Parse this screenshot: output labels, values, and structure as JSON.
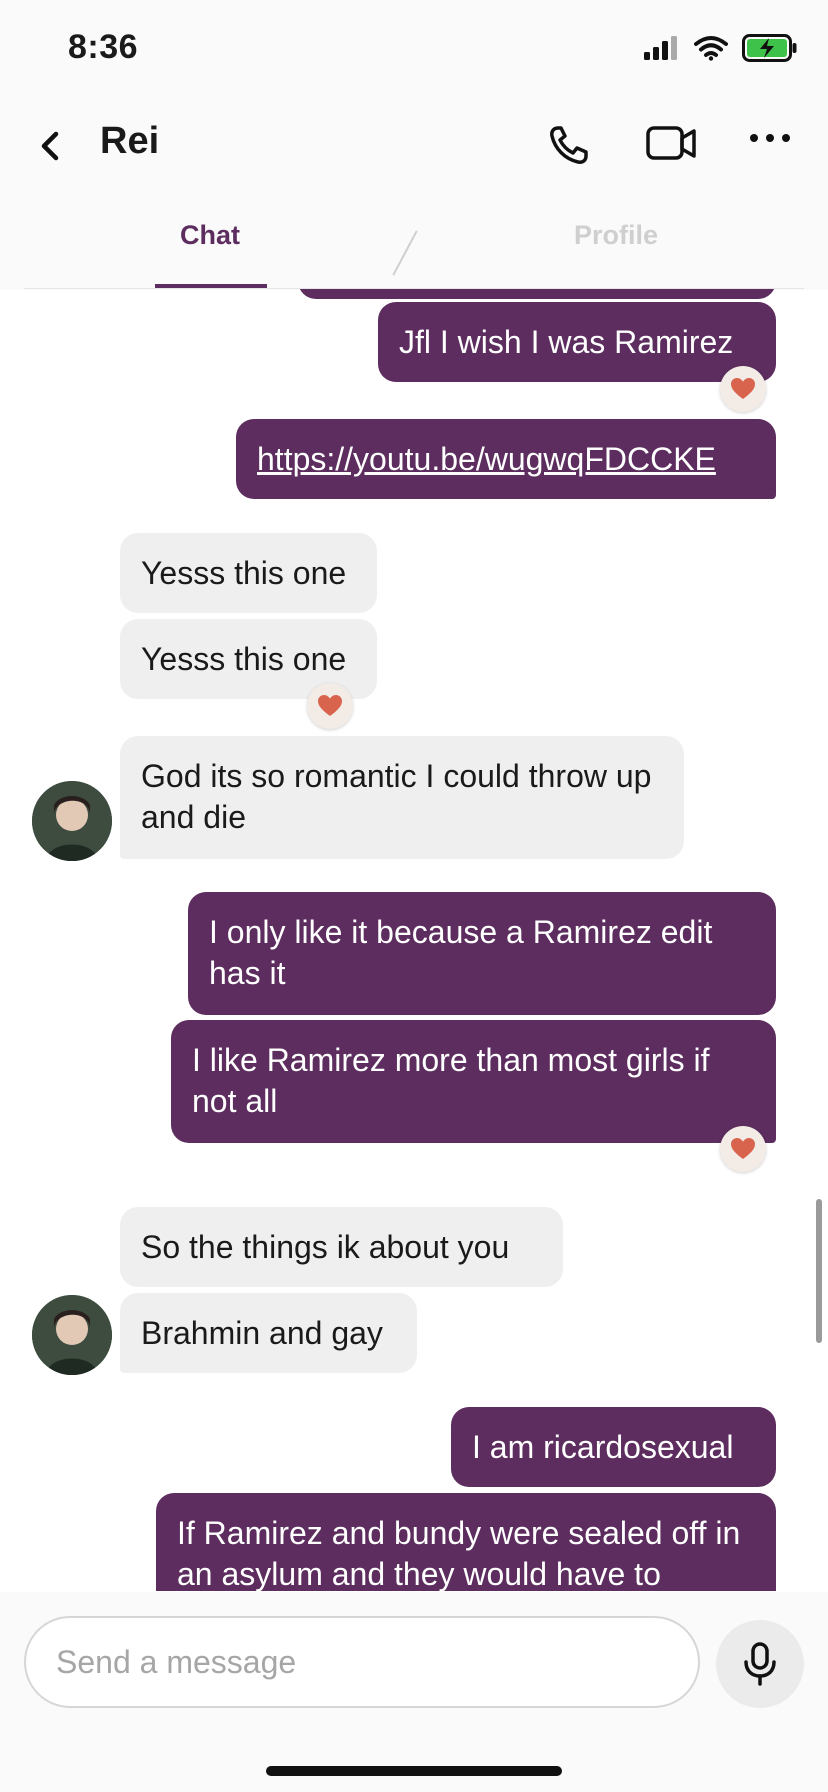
{
  "status": {
    "time": "8:36"
  },
  "header": {
    "contact_name": "Rei"
  },
  "tabs": {
    "chat": "Chat",
    "profile": "Profile"
  },
  "messages": [
    {
      "dir": "out",
      "text": "Jfl I wish I was Ramirez",
      "reaction": "heart"
    },
    {
      "dir": "out",
      "text": "https://youtu.be/wugwqFDCCKE",
      "is_link": true
    },
    {
      "dir": "in",
      "text": "Yesss this one"
    },
    {
      "dir": "in",
      "text": "Yesss this one",
      "reaction": "heart"
    },
    {
      "dir": "in",
      "text": "God its so romantic I could throw up and die"
    },
    {
      "dir": "out",
      "text": "I only like it because a Ramirez edit has it"
    },
    {
      "dir": "out",
      "text": "I like Ramirez more than most girls if not all",
      "reaction": "heart"
    },
    {
      "dir": "in",
      "text": "So the things ik about you"
    },
    {
      "dir": "in",
      "text": "Brahmin and gay"
    },
    {
      "dir": "out",
      "text": "I am ricardosexual"
    },
    {
      "dir": "out",
      "text": "If Ramirez and bundy were sealed off in an asylum and they would have to"
    }
  ],
  "composer": {
    "placeholder": "Send a message"
  },
  "colors": {
    "outgoing": "#5c2d5e",
    "incoming": "#efefef",
    "reaction_heart": "#d9644e"
  }
}
